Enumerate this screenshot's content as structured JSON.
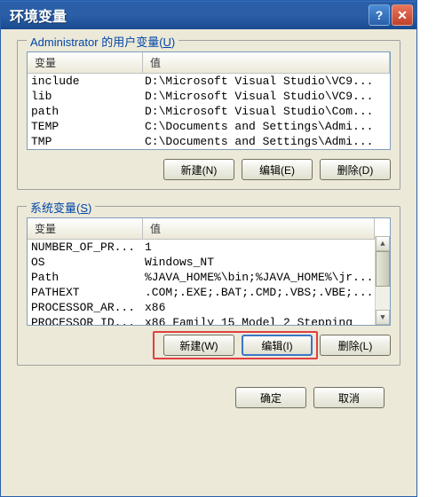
{
  "title": "环境变量",
  "userVars": {
    "legend_prefix": "Administrator 的用户变量(",
    "legend_letter": "U",
    "legend_suffix": ")",
    "col_name": "变量",
    "col_value": "值",
    "rows": [
      {
        "name": "include",
        "value": "D:\\Microsoft Visual Studio\\VC9..."
      },
      {
        "name": "lib",
        "value": "D:\\Microsoft Visual Studio\\VC9..."
      },
      {
        "name": "path",
        "value": "D:\\Microsoft Visual Studio\\Com..."
      },
      {
        "name": "TEMP",
        "value": "C:\\Documents and Settings\\Admi..."
      },
      {
        "name": "TMP",
        "value": "C:\\Documents and Settings\\Admi..."
      }
    ],
    "btn_new": "新建(N)",
    "btn_edit": "编辑(E)",
    "btn_delete": "删除(D)"
  },
  "sysVars": {
    "legend_prefix": "系统变量(",
    "legend_letter": "S",
    "legend_suffix": ")",
    "col_name": "变量",
    "col_value": "值",
    "rows": [
      {
        "name": "NUMBER_OF_PR...",
        "value": "1"
      },
      {
        "name": "OS",
        "value": "Windows_NT"
      },
      {
        "name": "Path",
        "value": "%JAVA_HOME%\\bin;%JAVA_HOME%\\jr..."
      },
      {
        "name": "PATHEXT",
        "value": ".COM;.EXE;.BAT;.CMD;.VBS;.VBE;..."
      },
      {
        "name": "PROCESSOR_AR...",
        "value": "x86"
      },
      {
        "name": "PROCESSOR_ID...",
        "value": "x86 Family 15 Model 2 Stepping"
      }
    ],
    "btn_new": "新建(W)",
    "btn_edit": "编辑(I)",
    "btn_delete": "删除(L)"
  },
  "ok": "确定",
  "cancel": "取消"
}
